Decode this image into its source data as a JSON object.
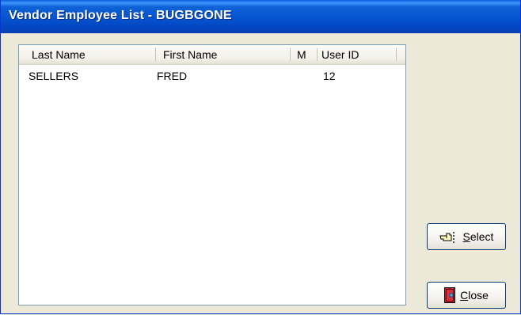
{
  "window": {
    "title": "Vendor Employee List - BUGBGONE"
  },
  "list": {
    "columns": [
      {
        "label": "Last Name"
      },
      {
        "label": "First Name"
      },
      {
        "label": "M"
      },
      {
        "label": "User ID"
      }
    ],
    "rows": [
      {
        "last_name": "SELLERS",
        "first_name": "FRED",
        "middle": "",
        "user_id": "12"
      }
    ]
  },
  "buttons": {
    "select": {
      "label": "Select",
      "icon": "pointing-hand-icon"
    },
    "close": {
      "label": "Close",
      "icon": "door-exit-icon"
    }
  },
  "colors": {
    "titlebar": "#0553d0",
    "title_text": "#ffffff",
    "dialog_background": "#ece9d8",
    "list_border": "#7f9db9"
  }
}
